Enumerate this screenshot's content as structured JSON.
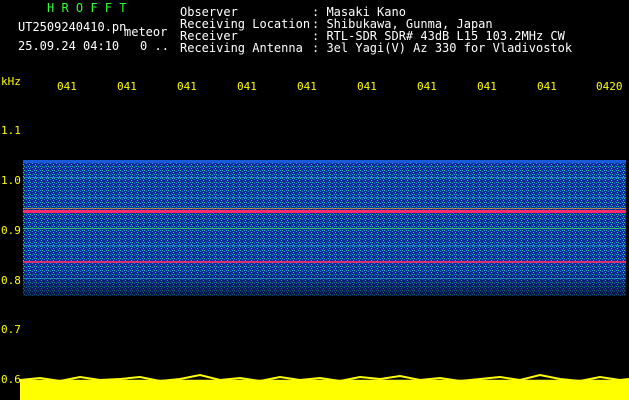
{
  "header": {
    "app_name": "H R O F F T",
    "filename": "UT2509240410.pn",
    "meteor_label": "meteor",
    "datetime": "25.09.24 04:10",
    "meteor_count": "0",
    "meteor_count_suffix": "..",
    "observer_label": "Observer",
    "observer_value": ": Masaki Kano",
    "location_label": "Receiving Location",
    "location_value": ": Shibukawa, Gunma, Japan",
    "receiver_label": "Receiver",
    "receiver_value": ": RTL-SDR SDR# 43dB L15 103.2MHz CW",
    "antenna_label": "Receiving Antenna",
    "antenna_value": ": 3el Yagi(V) Az 330 for Vladivostok"
  },
  "axes": {
    "y_unit": "kHz",
    "y_ticks": [
      "1.1",
      "1.0",
      "0.9",
      "0.8",
      "0.7",
      "0.6"
    ],
    "x_ticks": [
      "041",
      "041",
      "041",
      "041",
      "041",
      "041",
      "041",
      "041",
      "041",
      "0420"
    ]
  },
  "colors": {
    "background": "#000000",
    "text": "#ffffff",
    "title": "#33ff33",
    "axis": "#ffff00",
    "noise_low": "#0a2a9a",
    "noise_high": "#00e0ff",
    "carrier": "#ff2a6a",
    "amplitude": "#ffff00"
  }
}
